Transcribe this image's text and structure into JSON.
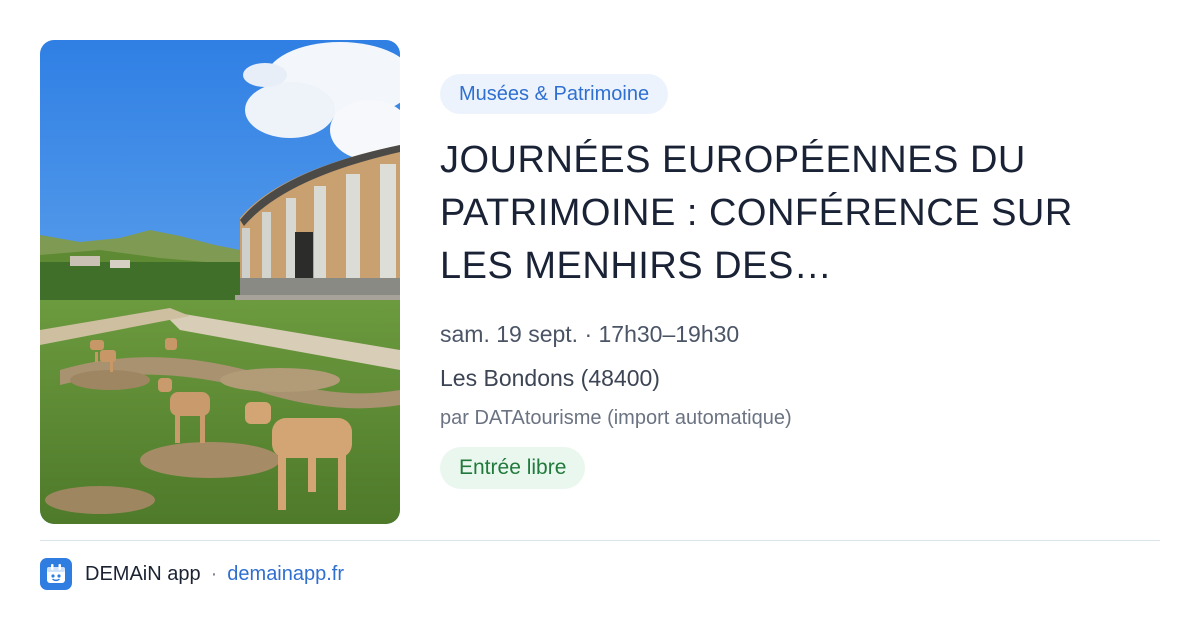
{
  "event": {
    "category": "Musées & Patrimoine",
    "title": "JOURNÉES EUROPÉENNES DU PATRIMOINE : CONFÉRENCE SUR LES MENHIRS DES…",
    "datetime": "sam. 19 sept. · 17h30–19h30",
    "location": "Les Bondons (48400)",
    "source": "par DATAtourisme (import automatique)",
    "price": "Entrée libre",
    "image_icon": "museum-photo"
  },
  "footer": {
    "app_name": "DEMAiN app",
    "separator": "·",
    "url": "demainapp.fr",
    "icon": "demain-app-icon"
  },
  "colors": {
    "category_bg": "#ecf3fd",
    "category_text": "#2f6fd0",
    "price_bg": "#eaf7ee",
    "price_text": "#217a3c",
    "link": "#2f6fd0",
    "app_icon_bg": "#2f7de0"
  }
}
